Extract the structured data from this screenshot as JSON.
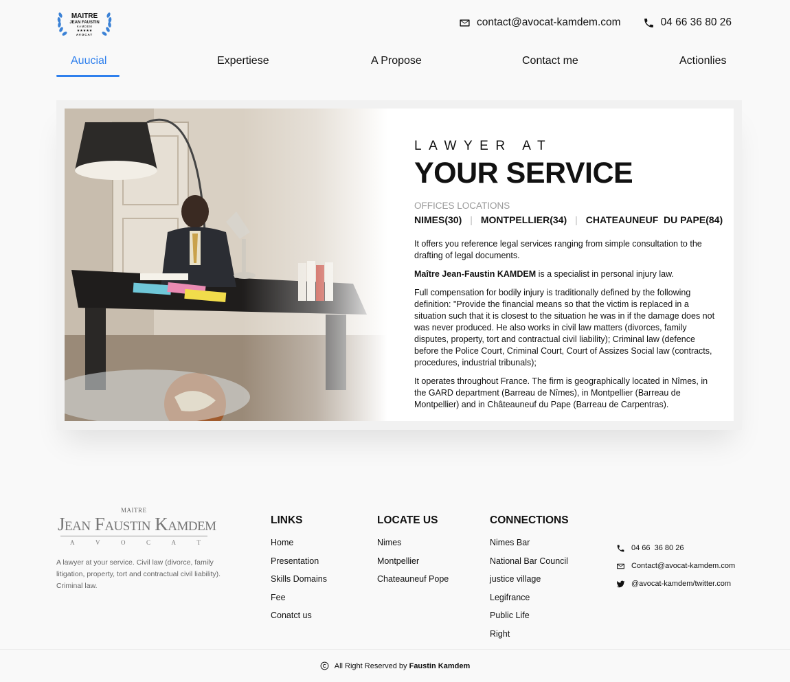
{
  "header": {
    "logo": {
      "line1": "MAITRE",
      "line2": "JEAN FAUSTIN",
      "line3": "KAMDEM",
      "stars": "★★★★★",
      "line4": "AVOCAT",
      "icon": "laurel-wreath-icon",
      "color": "#3b82d6"
    },
    "email": "contact@avocat-kamdem.com",
    "phone": "04 66 36 80 26"
  },
  "nav": {
    "accent_color": "#2f80ed",
    "items": [
      {
        "label": "Auucial",
        "active": true
      },
      {
        "label": "Expertiese",
        "active": false
      },
      {
        "label": "A Propose",
        "active": false
      },
      {
        "label": "Contact me",
        "active": false
      },
      {
        "label": "Actionlies",
        "active": false
      }
    ]
  },
  "hero": {
    "kicker": "LAWYER AT",
    "headline": "YOUR SERVICE",
    "offices_label": "OFFICES LOCATIONS",
    "offices": [
      "NIMES(30)",
      "MONTPELLIER(34)",
      "CHATEAUNEUF  DU PAPE(84)"
    ],
    "paragraph1": "It offers you reference legal services ranging from simple consultation to the drafting of legal documents.",
    "paragraph2_bold": "Maître Jean-Faustin KAMDEM",
    "paragraph2_rest": " is a specialist in personal injury law.",
    "paragraph3": "Full compensation for bodily injury is traditionally defined by the following definition: \"Provide the financial means so that the victim is replaced in a situation such that it is closest to the situation he was in if the damage does not was never produced. He also works in civil law matters (divorces, family disputes, property, tort and contractual civil liability); Criminal law (defence before the Police Court, Criminal Court, Court of Assizes Social law (contracts, procedures, industrial tribunals);",
    "paragraph4": "It operates throughout France. The firm is geographically located in Nîmes, in the GARD department (Barreau de Nîmes), in Montpellier (Barreau de Montpellier) and in Châteauneuf du Pape (Barreau de Carpentras)."
  },
  "footer": {
    "logo": {
      "maitre": "MAITRE",
      "name": "Jean Faustin Kamdem",
      "avocat": [
        "A",
        "V",
        "O",
        "C",
        "A",
        "T"
      ]
    },
    "description": "A lawyer at your service. Civil law (divorce, family litigation, property, tort and contractual civil liability). Criminal law.",
    "links": {
      "title": "LINKS",
      "items": [
        "Home",
        "Presentation",
        "Skills Domains",
        "Fee",
        "Conatct us"
      ]
    },
    "locate": {
      "title": "LOCATE US",
      "items": [
        "Nimes",
        "Montpellier",
        "Chateauneuf Pope"
      ]
    },
    "connections": {
      "title": "CONNECTIONS",
      "items": [
        "Nimes Bar",
        "National Bar Council",
        "justice village",
        "Legifrance",
        "Public Life",
        "Right"
      ]
    },
    "contact": {
      "phone": "04 66  36 80 26",
      "email": "Contact@avocat-kamdem.com",
      "twitter": "@avocat-kamdem/twitter.com"
    },
    "copyright_prefix": "All Right Reserved by ",
    "copyright_name": "Faustin Kamdem"
  }
}
